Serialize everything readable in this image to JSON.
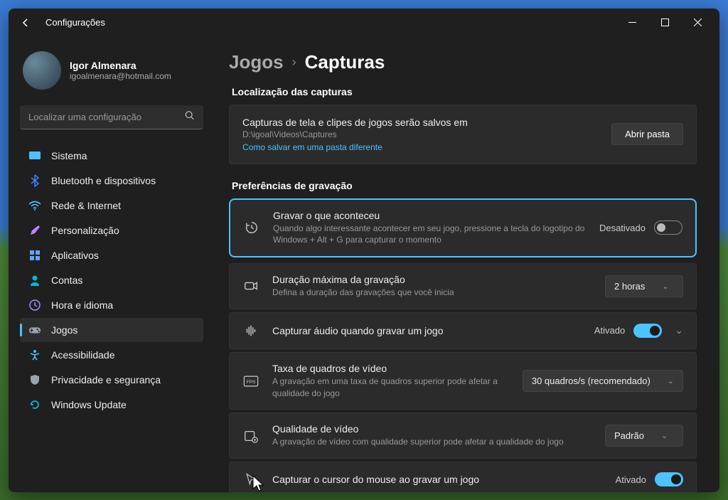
{
  "titlebar": {
    "title": "Configurações"
  },
  "profile": {
    "name": "Igor Almenara",
    "email": "igoalmenara@hotmail.com"
  },
  "search": {
    "placeholder": "Localizar uma configuração"
  },
  "nav": [
    {
      "key": "sistema",
      "label": "Sistema",
      "icon_color": "#4cc2ff"
    },
    {
      "key": "bluetooth",
      "label": "Bluetooth e dispositivos",
      "icon_color": "#3b82f6"
    },
    {
      "key": "rede",
      "label": "Rede & Internet",
      "icon_color": "#4cc2ff"
    },
    {
      "key": "personalizacao",
      "label": "Personalização",
      "icon_color": "#c084fc"
    },
    {
      "key": "aplicativos",
      "label": "Aplicativos",
      "icon_color": "#60a5fa"
    },
    {
      "key": "contas",
      "label": "Contas",
      "icon_color": "#06b6d4"
    },
    {
      "key": "hora",
      "label": "Hora e idioma",
      "icon_color": "#a78bfa"
    },
    {
      "key": "jogos",
      "label": "Jogos",
      "icon_color": "#9ca3af",
      "selected": true
    },
    {
      "key": "acessibilidade",
      "label": "Acessibilidade",
      "icon_color": "#4cc2ff"
    },
    {
      "key": "privacidade",
      "label": "Privacidade e segurança",
      "icon_color": "#9ca3af"
    },
    {
      "key": "update",
      "label": "Windows Update",
      "icon_color": "#06b6d4"
    }
  ],
  "breadcrumb": {
    "parent": "Jogos",
    "current": "Capturas"
  },
  "sections": {
    "location": {
      "header": "Localização das capturas",
      "title": "Capturas de tela e clipes de jogos serão salvos em",
      "path": "D:\\igoal\\Videos\\Captures",
      "link": "Como salvar em uma pasta diferente",
      "button": "Abrir pasta"
    },
    "prefs": {
      "header": "Preferências de gravação"
    },
    "record_happened": {
      "title": "Gravar o que aconteceu",
      "desc": "Quando algo interessante acontecer em seu jogo, pressione a tecla do logotipo do Windows + Alt + G para capturar o momento",
      "state_label": "Desativado"
    },
    "max_duration": {
      "title": "Duração máxima da gravação",
      "desc": "Defina a duração das gravações que você inicia",
      "value": "2 horas"
    },
    "capture_audio": {
      "title": "Capturar áudio quando gravar um jogo",
      "state_label": "Ativado"
    },
    "fps": {
      "title": "Taxa de quadros de vídeo",
      "desc": "A gravação em uma taxa de quadros superior pode afetar a qualidade do jogo",
      "value": "30 quadros/s (recomendado)"
    },
    "quality": {
      "title": "Qualidade de vídeo",
      "desc": "A gravação de vídeo com qualidade superior pode afetar a qualidade do jogo",
      "value": "Padrão"
    },
    "cursor": {
      "title": "Capturar o cursor do mouse ao gravar um jogo",
      "state_label": "Ativado"
    }
  }
}
